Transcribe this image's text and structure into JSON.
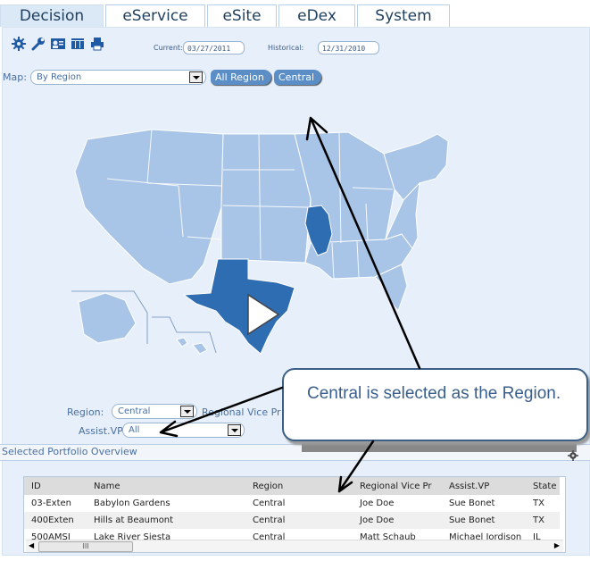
{
  "tabs": [
    "Decision",
    "eService",
    "eSite",
    "eDex",
    "System"
  ],
  "toolbar": {
    "current_label": "Current:",
    "current_value": "03/27/2011",
    "historical_label": "Historical:",
    "historical_value": "12/31/2010",
    "icons": [
      "gear-icon",
      "wrench-icon",
      "user-card-icon",
      "columns-icon",
      "print-icon"
    ]
  },
  "map": {
    "label": "Map:",
    "select_value": "By Region",
    "crumbs": [
      "All Region",
      "Central"
    ],
    "highlighted_states": [
      "TX",
      "IL"
    ],
    "base_color": "#a8c4e6",
    "highlight_color": "#2f6db3"
  },
  "filters": {
    "region_label": "Region:",
    "region_value": "Central",
    "rvp_label": "Regional Vice Pr",
    "assist_label": "Assist.VP:",
    "assist_value": "All"
  },
  "overview": {
    "title": "Selected Portfolio Overview",
    "columns": [
      "ID",
      "Name",
      "Region",
      "Regional Vice Pr",
      "Assist.VP",
      "State"
    ],
    "rows": [
      [
        "03-Exten",
        "Babylon Gardens",
        "Central",
        "Joe Doe",
        "Sue Bonet",
        "TX"
      ],
      [
        "400Exten",
        "Hills at Beaumont",
        "Central",
        "Joe Doe",
        "Sue Bonet",
        "TX"
      ],
      [
        "500AMSI",
        "Lake River Siesta",
        "Central",
        "Matt Schaub",
        "Michael Jordison",
        "IL"
      ]
    ],
    "scroll_thumb": "III"
  },
  "callout": {
    "text": "Central is selected as the Region."
  }
}
